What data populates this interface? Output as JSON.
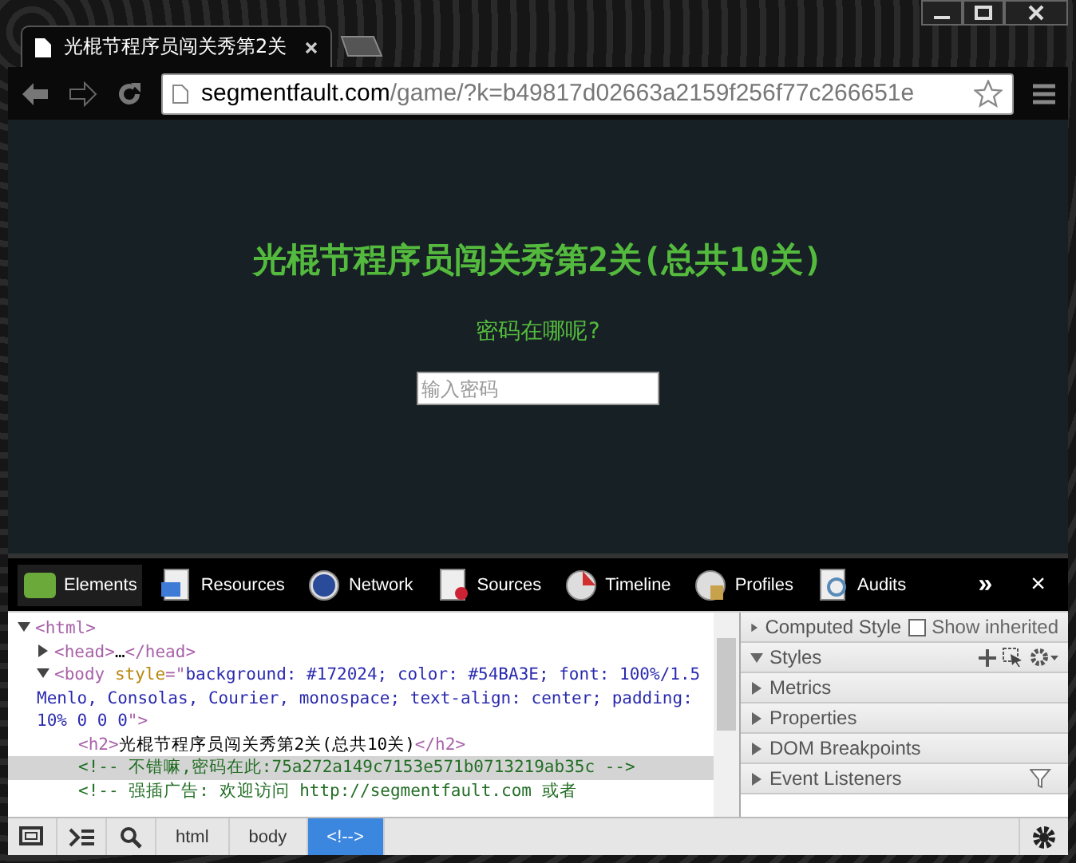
{
  "tab": {
    "title": "光棍节程序员闯关秀第2关"
  },
  "address_bar": {
    "host": "segmentfault.com",
    "path": "/game/?k=b49817d02663a2159f256f77c266651e"
  },
  "page": {
    "heading": "光棍节程序员闯关秀第2关(总共10关)",
    "prompt": "密码在哪呢?",
    "password_field": {
      "placeholder": "输入密码"
    }
  },
  "devtools": {
    "tabs": [
      {
        "label": "Elements",
        "kind": "elements",
        "selected": true
      },
      {
        "label": "Resources",
        "kind": "resources",
        "selected": false
      },
      {
        "label": "Network",
        "kind": "network",
        "selected": false
      },
      {
        "label": "Sources",
        "kind": "sources",
        "selected": false
      },
      {
        "label": "Timeline",
        "kind": "timeline",
        "selected": false
      },
      {
        "label": "Profiles",
        "kind": "profiles",
        "selected": false
      },
      {
        "label": "Audits",
        "kind": "audits",
        "selected": false
      }
    ],
    "more": "»",
    "close": "×",
    "dom_tree": [
      {
        "expanded": true,
        "selected": false,
        "parts": [
          {
            "kind": "tag",
            "text": "<html>"
          }
        ],
        "children": [
          {
            "expanded": false,
            "selected": false,
            "parts": [
              {
                "kind": "tag",
                "text": "<head>"
              },
              {
                "kind": "text",
                "text": "…"
              },
              {
                "kind": "tag",
                "text": "</head>"
              }
            ]
          },
          {
            "expanded": true,
            "selected": false,
            "parts": [
              {
                "kind": "tag",
                "text": "<body "
              },
              {
                "kind": "attr",
                "text": "style"
              },
              {
                "kind": "tag",
                "text": "=\""
              },
              {
                "kind": "value",
                "text": "background: #172024; color: #54BA3E; font: 100%/1.5 Menlo, Consolas, Courier, monospace; text-align: center; padding: 10% 0 0 0"
              },
              {
                "kind": "tag",
                "text": "\">"
              }
            ],
            "children": [
              {
                "selected": false,
                "parts": [
                  {
                    "kind": "tag",
                    "text": "<h2>"
                  },
                  {
                    "kind": "text",
                    "text": "光棍节程序员闯关秀第2关(总共10关)"
                  },
                  {
                    "kind": "tag",
                    "text": "</h2>"
                  }
                ]
              },
              {
                "selected": true,
                "parts": [
                  {
                    "kind": "comment",
                    "text": "<!-- 不错嘛,密码在此:75a272a149c7153e571b0713219ab35c -->"
                  }
                ]
              },
              {
                "selected": false,
                "parts": [
                  {
                    "kind": "comment",
                    "text": "<!-- 强插广告: 欢迎访问 http://segmentfault.com 或者"
                  }
                ]
              }
            ]
          }
        ]
      }
    ],
    "breadcrumbs": [
      {
        "label": "html",
        "selected": false
      },
      {
        "label": "body",
        "selected": false
      },
      {
        "label": "<!-->",
        "selected": true
      }
    ],
    "sidebar": [
      {
        "title": "Computed Style",
        "expanded": false,
        "kind": "computed"
      },
      {
        "title": "Styles",
        "expanded": true,
        "kind": "styles"
      },
      {
        "title": "Metrics",
        "expanded": false,
        "kind": "plain"
      },
      {
        "title": "Properties",
        "expanded": false,
        "kind": "plain"
      },
      {
        "title": "DOM Breakpoints",
        "expanded": false,
        "kind": "plain"
      },
      {
        "title": "Event Listeners",
        "expanded": false,
        "kind": "listeners"
      }
    ],
    "show_inherited": {
      "label": "Show inherited",
      "checked": false
    }
  }
}
